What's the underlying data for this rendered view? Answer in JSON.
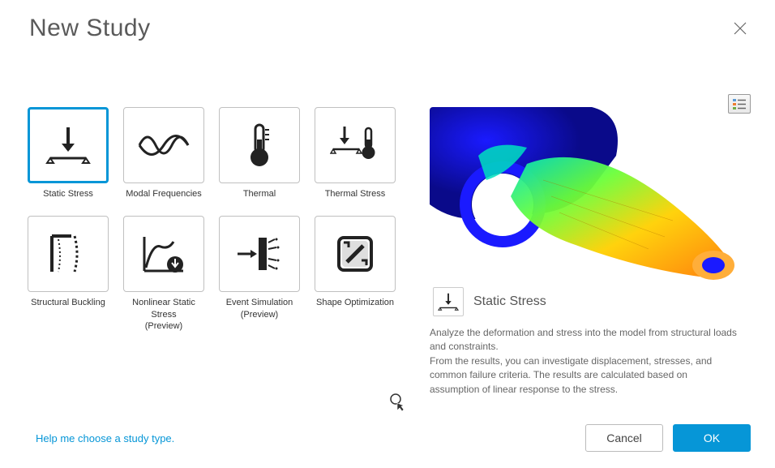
{
  "dialog": {
    "title": "New Study"
  },
  "studies": {
    "static_stress": {
      "label": "Static Stress"
    },
    "modal_frequencies": {
      "label": "Modal Frequencies"
    },
    "thermal": {
      "label": "Thermal"
    },
    "thermal_stress": {
      "label": "Thermal Stress"
    },
    "structural_buckling": {
      "label": "Structural Buckling"
    },
    "nonlinear_static_stress": {
      "label": "Nonlinear Static Stress",
      "sublabel": "(Preview)"
    },
    "event_simulation": {
      "label": "Event Simulation",
      "sublabel": "(Preview)"
    },
    "shape_optimization": {
      "label": "Shape Optimization"
    }
  },
  "detail": {
    "name": "Static Stress",
    "description": "Analyze the deformation and stress into the model from structural loads and constraints.\nFrom the results, you can investigate displacement, stresses, and common failure criteria. The results are calculated based on assumption of linear response to the stress."
  },
  "footer": {
    "help_link": "Help me choose a study type.",
    "cancel": "Cancel",
    "ok": "OK"
  }
}
